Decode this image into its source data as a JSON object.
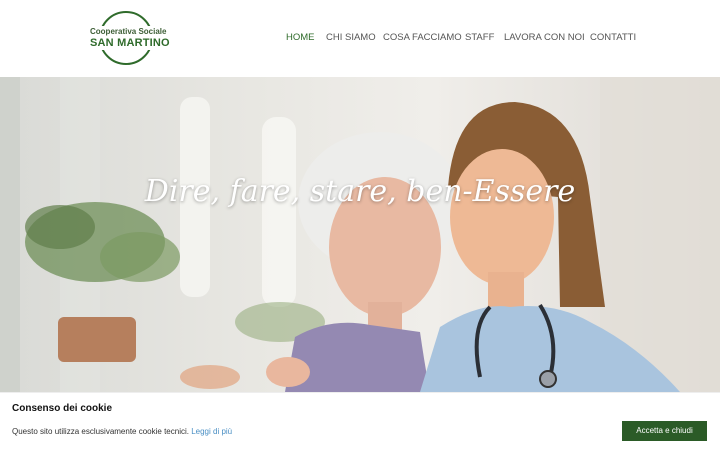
{
  "logo": {
    "line1": "Cooperativa Sociale",
    "line2": "SAN MARTINO"
  },
  "nav": [
    {
      "label": "HOME",
      "active": true
    },
    {
      "label": "CHI SIAMO",
      "active": false
    },
    {
      "label": "COSA FACCIAMO",
      "active": false
    },
    {
      "label": "STAFF",
      "active": false
    },
    {
      "label": "LAVORA CON NOI",
      "active": false
    },
    {
      "label": "CONTATTI",
      "active": false
    }
  ],
  "hero": {
    "title": "Dire, fare, stare, ben-Essere",
    "slides": 3,
    "current_slide": 1
  },
  "cookie": {
    "title": "Consenso dei cookie",
    "text": "Questo sito utilizza esclusivamente cookie tecnici.",
    "link": "Leggi di più",
    "accept": "Accetta e chiudi"
  },
  "colors": {
    "brand_green": "#2f6b2b",
    "button_green": "#2b5b27",
    "link_blue": "#4a8fc4"
  }
}
